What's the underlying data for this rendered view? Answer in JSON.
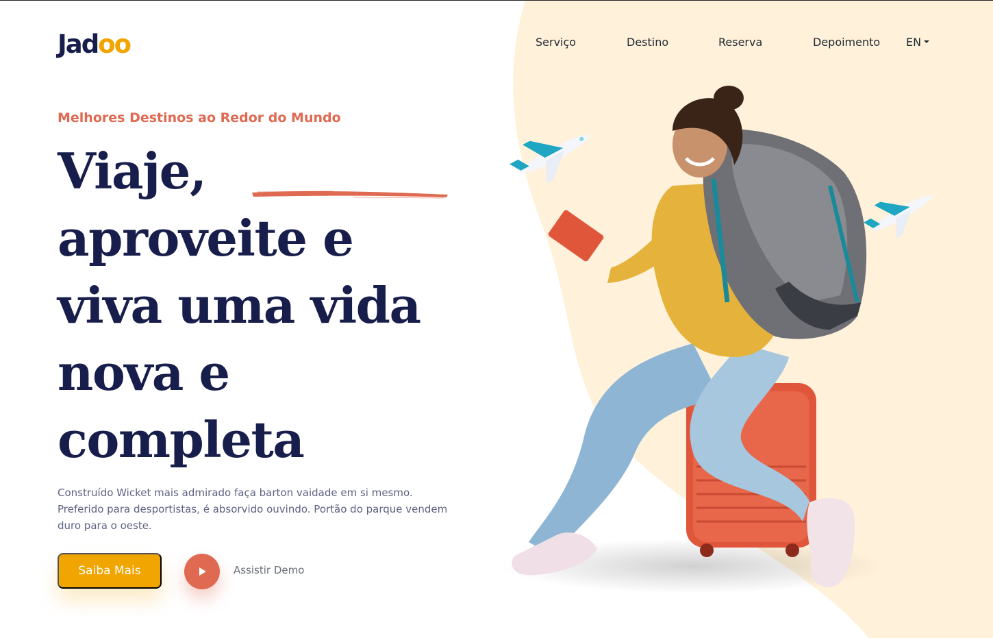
{
  "brand": {
    "logo_prefix": "Jad",
    "logo_suffix": "oo"
  },
  "nav": {
    "items": [
      {
        "label": "Serviço"
      },
      {
        "label": "Destino"
      },
      {
        "label": "Reserva"
      },
      {
        "label": "Depoimento"
      }
    ],
    "language": "EN"
  },
  "hero": {
    "subheading": "Melhores Destinos ao Redor do Mundo",
    "headline_lines": [
      "Viaje,",
      "aproveite e",
      "viva uma vida",
      "nova e",
      "completa"
    ],
    "description": "Construído Wicket mais admirado faça barton vaidade em si mesmo. Preferido para desportistas, é absorvido ouvindo. Portão do parque vendem duro para o oeste.",
    "cta_label": "Saiba Mais",
    "demo_label": "Assistir Demo"
  },
  "colors": {
    "navy": "#181e4b",
    "accent_yellow": "#f1a501",
    "accent_coral": "#df6951",
    "blob_cream": "#fff1da",
    "text_muted": "#5e6282"
  },
  "icons": {
    "play": "play-icon",
    "caret": "chevron-down-icon",
    "airplane": "airplane-icon"
  }
}
